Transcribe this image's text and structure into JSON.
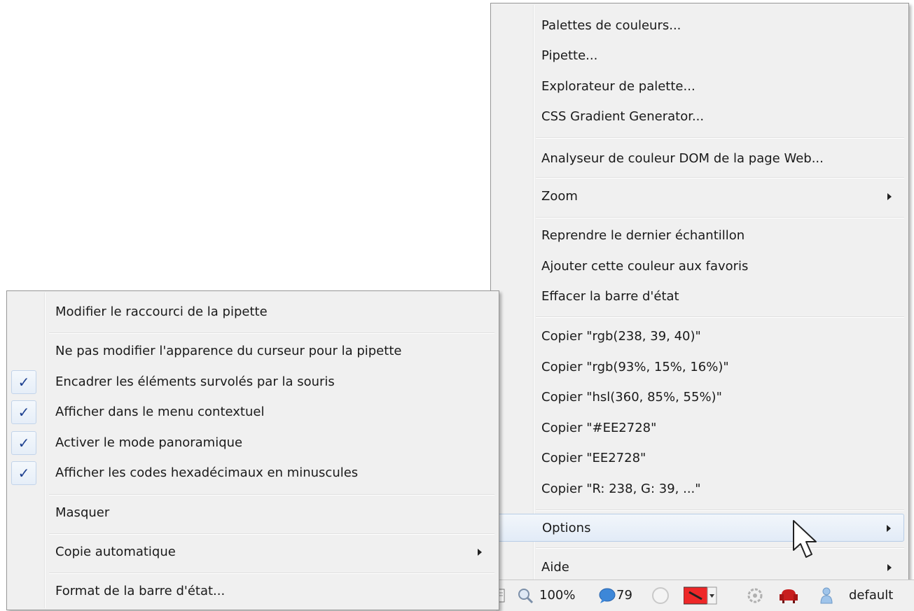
{
  "main_menu": {
    "items": [
      {
        "label": "Palettes de couleurs..."
      },
      {
        "label": "Pipette..."
      },
      {
        "label": "Explorateur de palette..."
      },
      {
        "label": "CSS Gradient Generator..."
      },
      {
        "label": "Analyseur de couleur DOM de la page Web..."
      },
      {
        "label": "Zoom"
      },
      {
        "label": "Reprendre le dernier échantillon"
      },
      {
        "label": "Ajouter cette couleur aux favoris"
      },
      {
        "label": "Effacer la barre d'état"
      },
      {
        "label": "Copier \"rgb(238, 39, 40)\""
      },
      {
        "label": "Copier \"rgb(93%, 15%, 16%)\""
      },
      {
        "label": "Copier \"hsl(360, 85%, 55%)\""
      },
      {
        "label": "Copier \"#EE2728\""
      },
      {
        "label": "Copier \"EE2728\""
      },
      {
        "label": "Copier \"R: 238, G: 39, ...\""
      },
      {
        "label": "Options"
      },
      {
        "label": "Aide"
      }
    ]
  },
  "options_menu": {
    "items": [
      {
        "label": "Modifier le raccourci de la pipette"
      },
      {
        "label": "Ne pas modifier l'apparence du curseur pour la pipette"
      },
      {
        "label": "Encadrer les éléments survolés par la souris",
        "checked": true
      },
      {
        "label": "Afficher dans le menu contextuel",
        "checked": true
      },
      {
        "label": "Activer le mode panoramique",
        "checked": true
      },
      {
        "label": "Afficher les codes hexadécimaux en minuscules",
        "checked": true
      },
      {
        "label": "Masquer"
      },
      {
        "label": "Copie automatique"
      },
      {
        "label": "Format de la barre d'état..."
      }
    ],
    "check_glyph": "✓"
  },
  "statusbar": {
    "zoom": "100%",
    "count": "79",
    "theme": "default",
    "swatch_color": "#EE2728"
  },
  "colors": {
    "menu_bg": "#f0f0f0",
    "highlight_border": "#b8cde6",
    "check_color": "#1c3f8f"
  }
}
